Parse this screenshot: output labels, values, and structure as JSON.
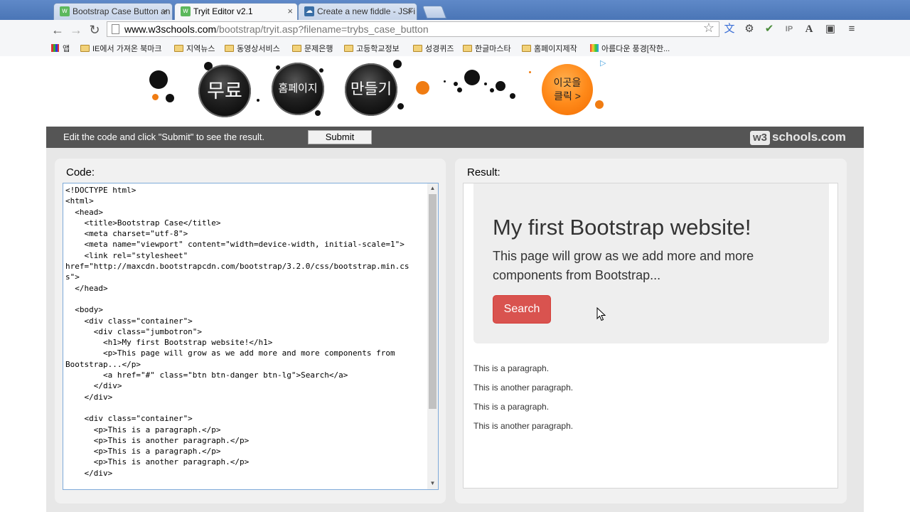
{
  "browser": {
    "tabs": [
      {
        "title": "Bootstrap Case Button an",
        "icon_color": "#5cb85c"
      },
      {
        "title": "Tryit Editor v2.1",
        "icon_color": "#5cb85c"
      },
      {
        "title": "Create a new fiddle - JSFi",
        "icon_color": "#3a6ea5"
      }
    ],
    "url_host": "www.w3schools.com",
    "url_path": "/bootstrap/tryit.asp?filename=trybs_case_button",
    "bookmarks": [
      "앱",
      "IE에서 가져온 북마크",
      "지역뉴스",
      "동영상서비스",
      "문제은행",
      "고등학교정보",
      "성경퀴즈",
      "한글마스타",
      "홈페이지제작",
      "아름다운 풍경[작한..."
    ]
  },
  "ad": {
    "ball1": "무료",
    "ball2": "홈페이지",
    "ball3": "만들기",
    "cta_line1": "이곳을",
    "cta_line2": "클릭 >"
  },
  "w3bar": {
    "instruction": "Edit the code and click \"Submit\" to see the result.",
    "submit_label": "Submit",
    "logo_w3": "w3",
    "logo_text": "schools.com"
  },
  "code_panel": {
    "label": "Code:",
    "code": "<!DOCTYPE html>\n<html>\n  <head>\n    <title>Bootstrap Case</title>\n    <meta charset=\"utf-8\">\n    <meta name=\"viewport\" content=\"width=device-width, initial-scale=1\">\n    <link rel=\"stylesheet\"\nhref=\"http://maxcdn.bootstrapcdn.com/bootstrap/3.2.0/css/bootstrap.min.cs\ns\">\n  </head>\n\n  <body>\n    <div class=\"container\">\n      <div class=\"jumbotron\">\n        <h1>My first Bootstrap website!</h1>\n        <p>This page will grow as we add more and more components from\nBootstrap...</p>\n        <a href=\"#\" class=\"btn btn-danger btn-lg\">Search</a>\n      </div>\n    </div>\n\n    <div class=\"container\">\n      <p>This is a paragraph.</p>\n      <p>This is another paragraph.</p>\n      <p>This is a paragraph.</p>\n      <p>This is another paragraph.</p>\n    </div>"
  },
  "result_panel": {
    "label": "Result:",
    "jumbotron_title": "My first Bootstrap website!",
    "jumbotron_text": "This page will grow as we add more and more components from Bootstrap...",
    "button_label": "Search",
    "button_color": "#d9534f",
    "paragraphs": [
      "This is a paragraph.",
      "This is another paragraph.",
      "This is a paragraph.",
      "This is another paragraph."
    ]
  }
}
